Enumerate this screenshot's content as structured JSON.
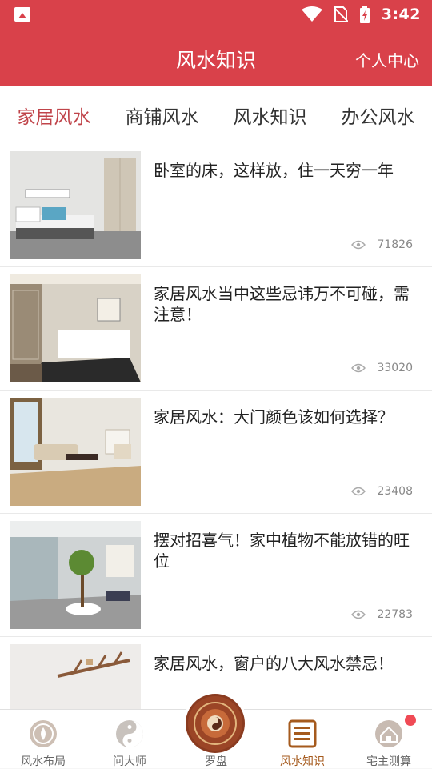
{
  "status": {
    "time": "3:42"
  },
  "header": {
    "title": "风水知识",
    "profile_label": "个人中心"
  },
  "tabs": [
    {
      "label": "家居风水",
      "active": true
    },
    {
      "label": "商铺风水",
      "active": false
    },
    {
      "label": "风水知识",
      "active": false
    },
    {
      "label": "办公风水",
      "active": false
    }
  ],
  "articles": [
    {
      "title": "卧室的床，这样放，住一天穷一年",
      "views": "71826"
    },
    {
      "title": "家居风水当中这些忌讳万不可碰，需注意！",
      "views": "33020"
    },
    {
      "title": "家居风水：大门颜色该如何选择？",
      "views": "23408"
    },
    {
      "title": "摆对招喜气！家中植物不能放错的旺位",
      "views": "22783"
    },
    {
      "title": "家居风水，窗户的八大风水禁忌！",
      "views": ""
    }
  ],
  "bottom_nav": [
    {
      "label": "风水布局",
      "icon": "lotus-icon",
      "active": false
    },
    {
      "label": "问大师",
      "icon": "yin-yang-icon",
      "active": false
    },
    {
      "label": "罗盘",
      "icon": "compass-icon",
      "active": false
    },
    {
      "label": "风水知识",
      "icon": "book-icon",
      "active": true
    },
    {
      "label": "宅主测算",
      "icon": "house-icon",
      "active": false,
      "badge": true
    }
  ],
  "colors": {
    "primary": "#d9414a",
    "active_tab": "#c0444a",
    "active_nav": "#a55a1d"
  }
}
